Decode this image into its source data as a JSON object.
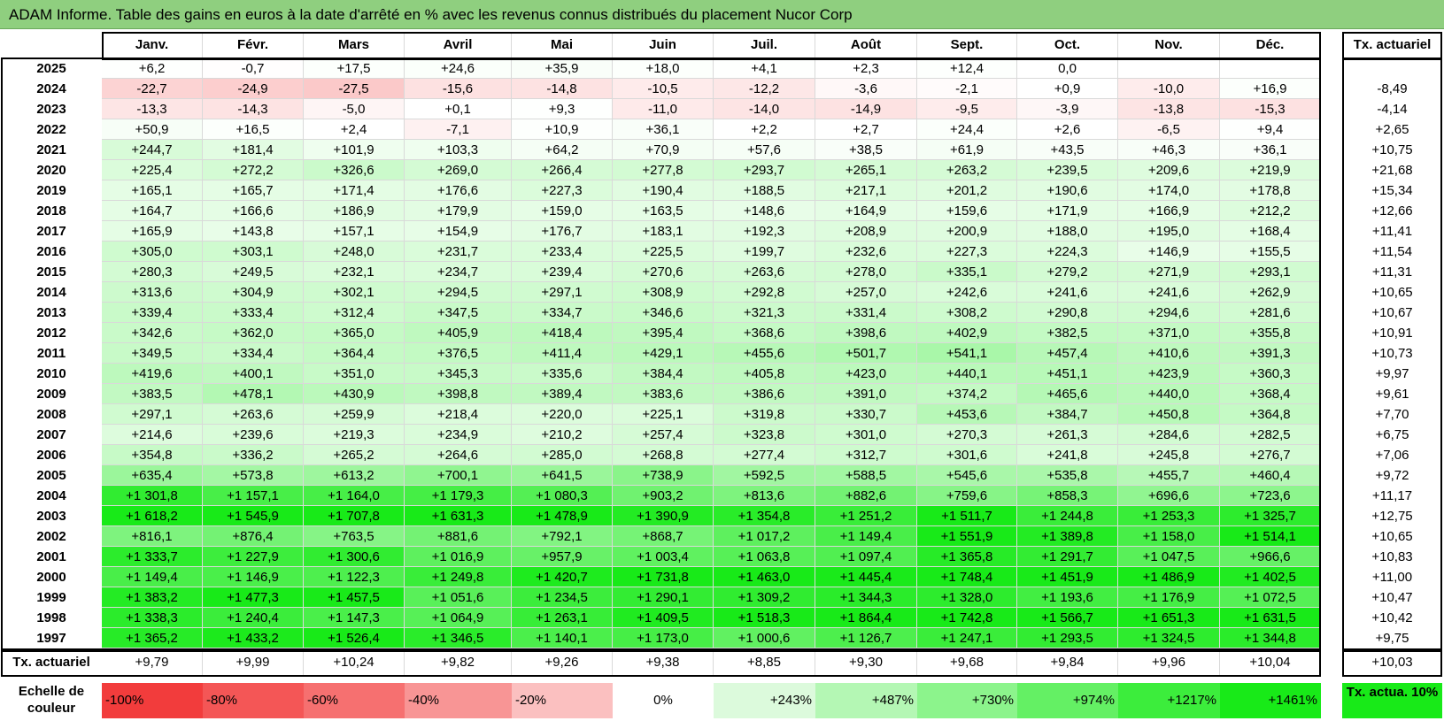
{
  "title": "ADAM Informe. Table des gains en euros à la date d'arrêté en % avec les revenus connus distribués du placement Nucor Corp",
  "months": [
    "Janv.",
    "Févr.",
    "Mars",
    "Avril",
    "Mai",
    "Juin",
    "Juil.",
    "Août",
    "Sept.",
    "Oct.",
    "Nov.",
    "Déc."
  ],
  "tx_header": "Tx. actuariel",
  "rows": [
    {
      "year": "2025",
      "values": [
        "+6,2",
        "-0,7",
        "+17,5",
        "+24,6",
        "+35,9",
        "+18,0",
        "+4,1",
        "+2,3",
        "+12,4",
        "0,0",
        "",
        ""
      ],
      "tx": ""
    },
    {
      "year": "2024",
      "values": [
        "-22,7",
        "-24,9",
        "-27,5",
        "-15,6",
        "-14,8",
        "-10,5",
        "-12,2",
        "-3,6",
        "-2,1",
        "+0,9",
        "-10,0",
        "+16,9"
      ],
      "tx": "-8,49"
    },
    {
      "year": "2023",
      "values": [
        "-13,3",
        "-14,3",
        "-5,0",
        "+0,1",
        "+9,3",
        "-11,0",
        "-14,0",
        "-14,9",
        "-9,5",
        "-3,9",
        "-13,8",
        "-15,3"
      ],
      "tx": "-4,14"
    },
    {
      "year": "2022",
      "values": [
        "+50,9",
        "+16,5",
        "+2,4",
        "-7,1",
        "+10,9",
        "+36,1",
        "+2,2",
        "+2,7",
        "+24,4",
        "+2,6",
        "-6,5",
        "+9,4"
      ],
      "tx": "+2,65"
    },
    {
      "year": "2021",
      "values": [
        "+244,7",
        "+181,4",
        "+101,9",
        "+103,3",
        "+64,2",
        "+70,9",
        "+57,6",
        "+38,5",
        "+61,9",
        "+43,5",
        "+46,3",
        "+36,1"
      ],
      "tx": "+10,75"
    },
    {
      "year": "2020",
      "values": [
        "+225,4",
        "+272,2",
        "+326,6",
        "+269,0",
        "+266,4",
        "+277,8",
        "+293,7",
        "+265,1",
        "+263,2",
        "+239,5",
        "+209,6",
        "+219,9"
      ],
      "tx": "+21,68"
    },
    {
      "year": "2019",
      "values": [
        "+165,1",
        "+165,7",
        "+171,4",
        "+176,6",
        "+227,3",
        "+190,4",
        "+188,5",
        "+217,1",
        "+201,2",
        "+190,6",
        "+174,0",
        "+178,8"
      ],
      "tx": "+15,34"
    },
    {
      "year": "2018",
      "values": [
        "+164,7",
        "+166,6",
        "+186,9",
        "+179,9",
        "+159,0",
        "+163,5",
        "+148,6",
        "+164,9",
        "+159,6",
        "+171,9",
        "+166,9",
        "+212,2"
      ],
      "tx": "+12,66"
    },
    {
      "year": "2017",
      "values": [
        "+165,9",
        "+143,8",
        "+157,1",
        "+154,9",
        "+176,7",
        "+183,1",
        "+192,3",
        "+208,9",
        "+200,9",
        "+188,0",
        "+195,0",
        "+168,4"
      ],
      "tx": "+11,41"
    },
    {
      "year": "2016",
      "values": [
        "+305,0",
        "+303,1",
        "+248,0",
        "+231,7",
        "+233,4",
        "+225,5",
        "+199,7",
        "+232,6",
        "+227,3",
        "+224,3",
        "+146,9",
        "+155,5"
      ],
      "tx": "+11,54"
    },
    {
      "year": "2015",
      "values": [
        "+280,3",
        "+249,5",
        "+232,1",
        "+234,7",
        "+239,4",
        "+270,6",
        "+263,6",
        "+278,0",
        "+335,1",
        "+279,2",
        "+271,9",
        "+293,1"
      ],
      "tx": "+11,31"
    },
    {
      "year": "2014",
      "values": [
        "+313,6",
        "+304,9",
        "+302,1",
        "+294,5",
        "+297,1",
        "+308,9",
        "+292,8",
        "+257,0",
        "+242,6",
        "+241,6",
        "+241,6",
        "+262,9"
      ],
      "tx": "+10,65"
    },
    {
      "year": "2013",
      "values": [
        "+339,4",
        "+333,4",
        "+312,4",
        "+347,5",
        "+334,7",
        "+346,6",
        "+321,3",
        "+331,4",
        "+308,2",
        "+290,8",
        "+294,6",
        "+281,6"
      ],
      "tx": "+10,67"
    },
    {
      "year": "2012",
      "values": [
        "+342,6",
        "+362,0",
        "+365,0",
        "+405,9",
        "+418,4",
        "+395,4",
        "+368,6",
        "+398,6",
        "+402,9",
        "+382,5",
        "+371,0",
        "+355,8"
      ],
      "tx": "+10,91"
    },
    {
      "year": "2011",
      "values": [
        "+349,5",
        "+334,4",
        "+364,4",
        "+376,5",
        "+411,4",
        "+429,1",
        "+455,6",
        "+501,7",
        "+541,1",
        "+457,4",
        "+410,6",
        "+391,3"
      ],
      "tx": "+10,73"
    },
    {
      "year": "2010",
      "values": [
        "+419,6",
        "+400,1",
        "+351,0",
        "+345,3",
        "+335,6",
        "+384,4",
        "+405,8",
        "+423,0",
        "+440,1",
        "+451,1",
        "+423,9",
        "+360,3"
      ],
      "tx": "+9,97"
    },
    {
      "year": "2009",
      "values": [
        "+383,5",
        "+478,1",
        "+430,9",
        "+398,8",
        "+389,4",
        "+383,6",
        "+386,6",
        "+391,0",
        "+374,2",
        "+465,6",
        "+440,0",
        "+368,4"
      ],
      "tx": "+9,61"
    },
    {
      "year": "2008",
      "values": [
        "+297,1",
        "+263,6",
        "+259,9",
        "+218,4",
        "+220,0",
        "+225,1",
        "+319,8",
        "+330,7",
        "+453,6",
        "+384,7",
        "+450,8",
        "+364,8"
      ],
      "tx": "+7,70"
    },
    {
      "year": "2007",
      "values": [
        "+214,6",
        "+239,6",
        "+219,3",
        "+234,9",
        "+210,2",
        "+257,4",
        "+323,8",
        "+301,0",
        "+270,3",
        "+261,3",
        "+284,6",
        "+282,5"
      ],
      "tx": "+6,75"
    },
    {
      "year": "2006",
      "values": [
        "+354,8",
        "+336,2",
        "+265,2",
        "+264,6",
        "+285,0",
        "+268,8",
        "+277,4",
        "+312,7",
        "+301,6",
        "+241,8",
        "+245,8",
        "+276,7"
      ],
      "tx": "+7,06"
    },
    {
      "year": "2005",
      "values": [
        "+635,4",
        "+573,8",
        "+613,2",
        "+700,1",
        "+641,5",
        "+738,9",
        "+592,5",
        "+588,5",
        "+545,6",
        "+535,8",
        "+455,7",
        "+460,4"
      ],
      "tx": "+9,72"
    },
    {
      "year": "2004",
      "values": [
        "+1 301,8",
        "+1 157,1",
        "+1 164,0",
        "+1 179,3",
        "+1 080,3",
        "+903,2",
        "+813,6",
        "+882,6",
        "+759,6",
        "+858,3",
        "+696,6",
        "+723,6"
      ],
      "tx": "+11,17"
    },
    {
      "year": "2003",
      "values": [
        "+1 618,2",
        "+1 545,9",
        "+1 707,8",
        "+1 631,3",
        "+1 478,9",
        "+1 390,9",
        "+1 354,8",
        "+1 251,2",
        "+1 511,7",
        "+1 244,8",
        "+1 253,3",
        "+1 325,7"
      ],
      "tx": "+12,75"
    },
    {
      "year": "2002",
      "values": [
        "+816,1",
        "+876,4",
        "+763,5",
        "+881,6",
        "+792,1",
        "+868,7",
        "+1 017,2",
        "+1 149,4",
        "+1 551,9",
        "+1 389,8",
        "+1 158,0",
        "+1 514,1"
      ],
      "tx": "+10,65"
    },
    {
      "year": "2001",
      "values": [
        "+1 333,7",
        "+1 227,9",
        "+1 300,6",
        "+1 016,9",
        "+957,9",
        "+1 003,4",
        "+1 063,8",
        "+1 097,4",
        "+1 365,8",
        "+1 291,7",
        "+1 047,5",
        "+966,6"
      ],
      "tx": "+10,83"
    },
    {
      "year": "2000",
      "values": [
        "+1 149,4",
        "+1 146,9",
        "+1 122,3",
        "+1 249,8",
        "+1 420,7",
        "+1 731,8",
        "+1 463,0",
        "+1 445,4",
        "+1 748,4",
        "+1 451,9",
        "+1 486,9",
        "+1 402,5"
      ],
      "tx": "+11,00"
    },
    {
      "year": "1999",
      "values": [
        "+1 383,2",
        "+1 477,3",
        "+1 457,5",
        "+1 051,6",
        "+1 234,5",
        "+1 290,1",
        "+1 309,2",
        "+1 344,3",
        "+1 328,0",
        "+1 193,6",
        "+1 176,9",
        "+1 072,5"
      ],
      "tx": "+10,47"
    },
    {
      "year": "1998",
      "values": [
        "+1 338,3",
        "+1 240,4",
        "+1 147,3",
        "+1 064,9",
        "+1 263,1",
        "+1 409,5",
        "+1 518,3",
        "+1 864,4",
        "+1 742,8",
        "+1 566,7",
        "+1 651,3",
        "+1 631,5"
      ],
      "tx": "+10,42"
    },
    {
      "year": "1997",
      "values": [
        "+1 365,2",
        "+1 433,2",
        "+1 526,4",
        "+1 346,5",
        "+1 140,1",
        "+1 173,0",
        "+1 000,6",
        "+1 126,7",
        "+1 247,1",
        "+1 293,5",
        "+1 324,5",
        "+1 344,8"
      ],
      "tx": "+9,75"
    }
  ],
  "footer": {
    "label": "Tx. actuariel",
    "values": [
      "+9,79",
      "+9,99",
      "+10,24",
      "+9,82",
      "+9,26",
      "+9,38",
      "+8,85",
      "+9,30",
      "+9,68",
      "+9,84",
      "+9,96",
      "+10,04"
    ],
    "total": "+10,03"
  },
  "legend": {
    "label": "Echelle de couleur",
    "items": [
      {
        "text": "-100%",
        "color": "#f23c3c"
      },
      {
        "text": "-80%",
        "color": "#f45656"
      },
      {
        "text": "-60%",
        "color": "#f67070"
      },
      {
        "text": "-40%",
        "color": "#f89595"
      },
      {
        "text": "-20%",
        "color": "#fbc0c0"
      },
      {
        "text": "0%",
        "color": "#ffffff"
      },
      {
        "text": "+243%",
        "color": "#dcfadc"
      },
      {
        "text": "+487%",
        "color": "#b4f7b4"
      },
      {
        "text": "+730%",
        "color": "#8cf48c"
      },
      {
        "text": "+974%",
        "color": "#64f064"
      },
      {
        "text": "+1217%",
        "color": "#3ced3c"
      },
      {
        "text": "+1461%",
        "color": "#18ea18"
      }
    ],
    "tx_label": "Tx. actua. 10%",
    "tx_color": "#18ea18"
  }
}
